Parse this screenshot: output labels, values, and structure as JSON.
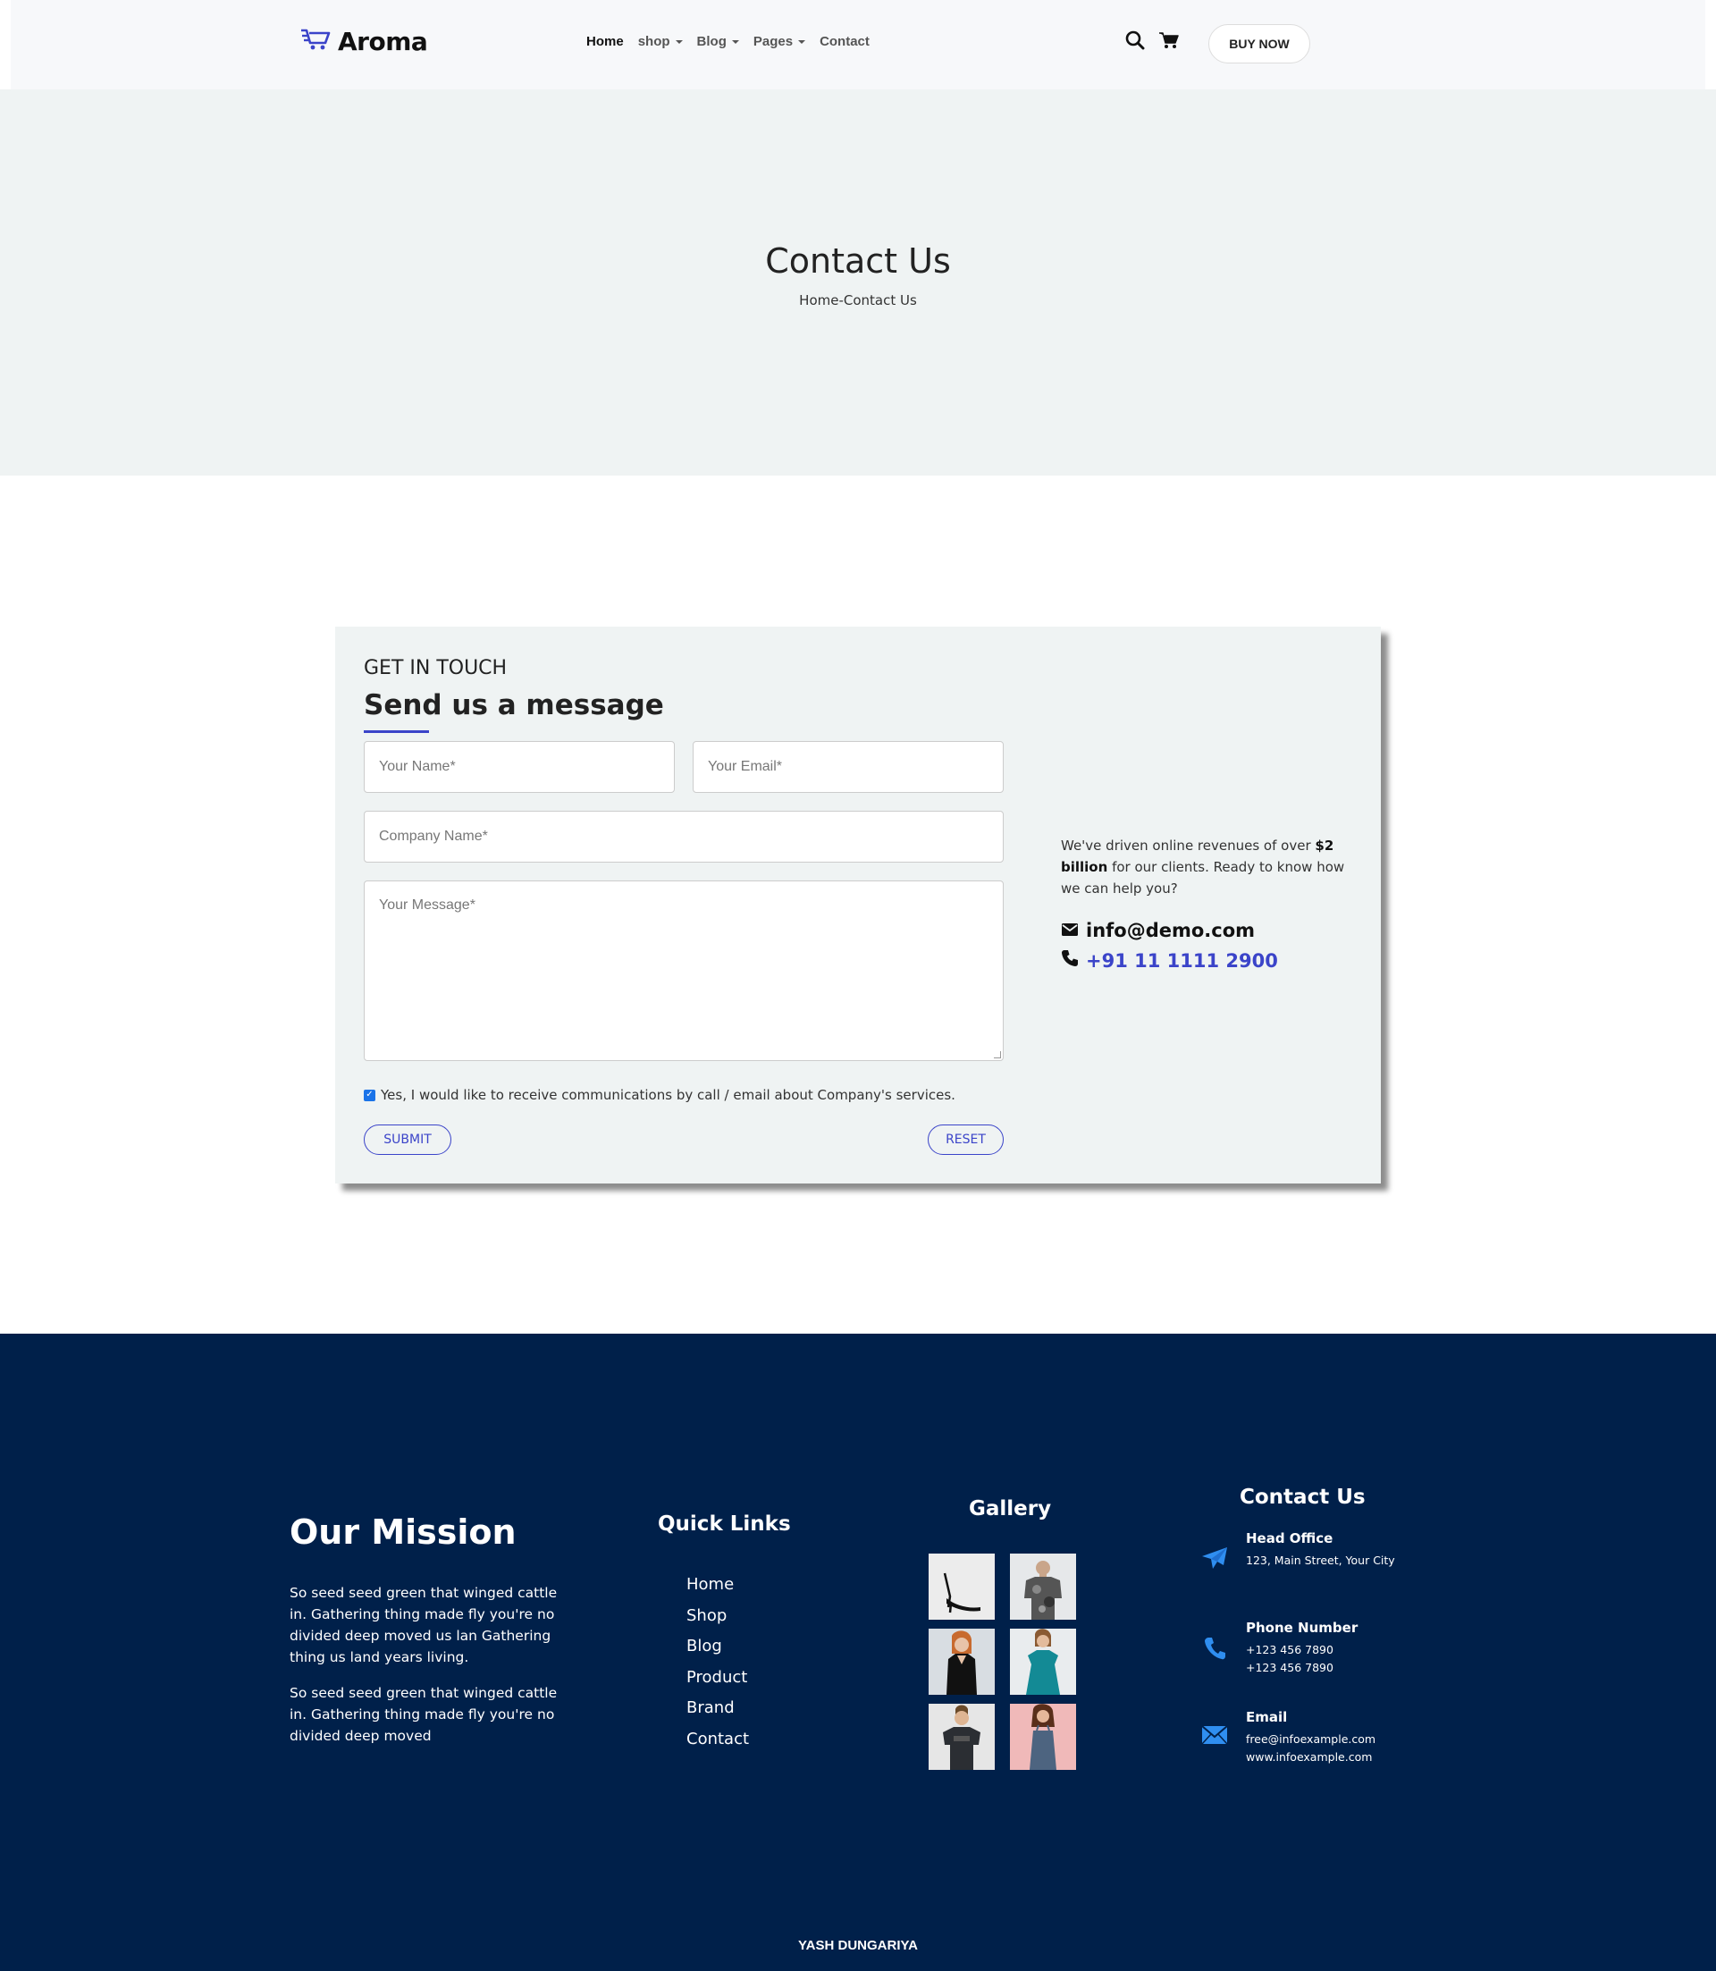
{
  "header": {
    "brand": "Aroma",
    "nav": [
      {
        "label": "Home",
        "active": true,
        "dropdown": false
      },
      {
        "label": "shop",
        "active": false,
        "dropdown": true
      },
      {
        "label": "Blog",
        "active": false,
        "dropdown": true
      },
      {
        "label": "Pages",
        "active": false,
        "dropdown": true
      },
      {
        "label": "Contact",
        "active": false,
        "dropdown": false
      }
    ],
    "icons": [
      "search-icon",
      "cart-icon"
    ],
    "buy_label": "BUY NOW"
  },
  "banner": {
    "title": "Contact Us",
    "breadcrumb": "Home-Contact Us"
  },
  "contact_form": {
    "eyebrow": "GET IN TOUCH",
    "title": "Send us a message",
    "name_placeholder": "Your Name*",
    "email_placeholder": "Your Email*",
    "company_placeholder": "Company Name*",
    "message_placeholder": "Your Message*",
    "consent_text": "Yes, I would like to receive communications by call / email about Company's services.",
    "consent_checked": true,
    "submit_label": "SUBMIT",
    "reset_label": "RESET",
    "side_text_before": "We've driven online revenues of over ",
    "side_text_bold": "$2 billion",
    "side_text_after": " for our clients. Ready to know how we can help you?",
    "email": "info@demo.com",
    "phone": "+91 11 1111 2900",
    "accent_color": "#3b44c9"
  },
  "footer": {
    "background": "#00204a",
    "mission_title": "Our Mission",
    "mission_p1": "So seed seed green that winged cattle in. Gathering thing made fly you're no divided deep moved us lan Gathering thing us land years living.",
    "mission_p2": "So seed seed green that winged cattle in. Gathering thing made fly you're no divided deep moved",
    "quick_links_title": "Quick Links",
    "quick_links": [
      "Home",
      "Shop",
      "Blog",
      "Product",
      "Brand",
      "Contact"
    ],
    "gallery_title": "Gallery",
    "gallery_items": [
      "heels",
      "man-camo-shirt",
      "woman-black-dress",
      "woman-teal-dress",
      "man-tshirt",
      "woman-blue-dress"
    ],
    "contact_title": "Contact Us",
    "head_office_label": "Head Office",
    "head_office_address": "123, Main Street, Your City",
    "phone_label": "Phone Number",
    "phone_1": "+123 456 7890",
    "phone_2": "+123 456 7890",
    "email_label": "Email",
    "email_1": "free@infoexample.com",
    "email_2": "www.infoexample.com",
    "credit": "YASH DUNGARIYA"
  }
}
